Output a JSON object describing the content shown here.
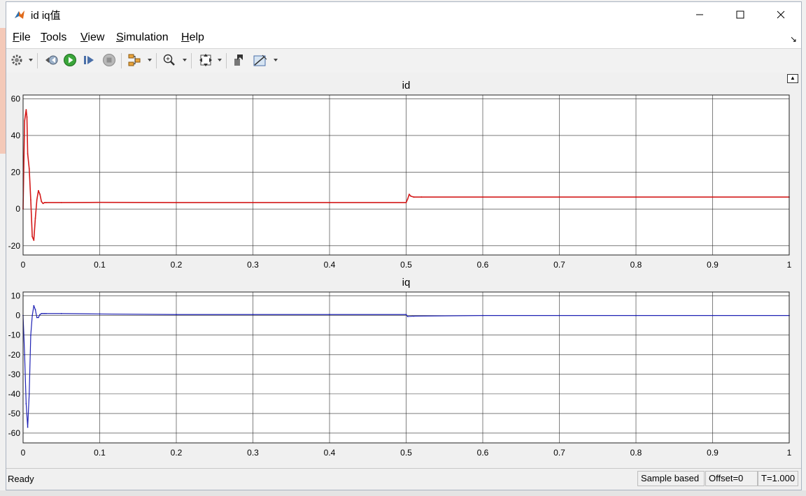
{
  "window": {
    "title": "id iq值",
    "minimize_icon": "minimize-icon",
    "maximize_icon": "maximize-icon",
    "close_icon": "close-icon"
  },
  "menu": {
    "items": [
      {
        "label": "File",
        "accel": "F",
        "rest": "ile"
      },
      {
        "label": "Tools",
        "accel": "T",
        "rest": "ools"
      },
      {
        "label": "View",
        "accel": "V",
        "rest": "iew"
      },
      {
        "label": "Simulation",
        "accel": "S",
        "rest": "imulation"
      },
      {
        "label": "Help",
        "accel": "H",
        "rest": "elp"
      }
    ]
  },
  "toolbar": {
    "icons": [
      "gear-icon",
      "step-back-icon",
      "run-icon",
      "step-forward-icon",
      "stop-icon",
      "signal-select-icon",
      "zoom-icon",
      "fit-icon",
      "highlight-icon",
      "measure-icon"
    ]
  },
  "status": {
    "ready": "Ready",
    "sample_mode": "Sample based",
    "offset": "Offset=0",
    "time": "T=1.000"
  },
  "colors": {
    "id_line": "#d41a1a",
    "iq_line": "#1f22b4",
    "grid": "#2b2b2b"
  },
  "chart_data": [
    {
      "type": "line",
      "title": "id",
      "xlim": [
        0,
        1
      ],
      "ylim": [
        -25,
        62
      ],
      "xticks": [
        0,
        0.1,
        0.2,
        0.3,
        0.4,
        0.5,
        0.6,
        0.7,
        0.8,
        0.9,
        1
      ],
      "xtick_labels": [
        "0",
        "0.1",
        "0.2",
        "0.3",
        "0.4",
        "0.5",
        "0.6",
        "0.7",
        "0.8",
        "0.9",
        "1"
      ],
      "yticks": [
        -20,
        0,
        20,
        40,
        60
      ],
      "ytick_labels": [
        "-20",
        "0",
        "20",
        "40",
        "60"
      ],
      "grid": true,
      "series": [
        {
          "x": [
            0,
            0.002,
            0.004,
            0.005,
            0.006,
            0.008,
            0.01,
            0.012,
            0.014,
            0.016,
            0.018,
            0.02,
            0.022,
            0.024,
            0.026,
            0.028,
            0.03,
            0.05,
            0.1,
            0.2,
            0.3,
            0.4,
            0.5,
            0.502,
            0.504,
            0.506,
            0.51,
            0.52,
            0.6,
            0.7,
            0.8,
            0.9,
            1.0
          ],
          "y": [
            0,
            48,
            54,
            50,
            30,
            22,
            5,
            -15,
            -17,
            -5,
            5,
            10,
            8,
            4,
            3,
            3.5,
            3.5,
            3.5,
            3.6,
            3.5,
            3.5,
            3.5,
            3.5,
            5.5,
            8,
            7,
            6.5,
            6.5,
            6.5,
            6.5,
            6.5,
            6.5,
            6.5
          ]
        }
      ]
    },
    {
      "type": "line",
      "title": "iq",
      "xlim": [
        0,
        1
      ],
      "ylim": [
        -65,
        12
      ],
      "xticks": [
        0,
        0.1,
        0.2,
        0.3,
        0.4,
        0.5,
        0.6,
        0.7,
        0.8,
        0.9,
        1
      ],
      "xtick_labels": [
        "0",
        "0.1",
        "0.2",
        "0.3",
        "0.4",
        "0.5",
        "0.6",
        "0.7",
        "0.8",
        "0.9",
        "1"
      ],
      "yticks": [
        -60,
        -50,
        -40,
        -30,
        -20,
        -10,
        0,
        10
      ],
      "ytick_labels": [
        "-60",
        "-50",
        "-40",
        "-30",
        "-20",
        "-10",
        "0",
        "10"
      ],
      "grid": true,
      "series": [
        {
          "x": [
            0,
            0.002,
            0.004,
            0.006,
            0.008,
            0.01,
            0.012,
            0.014,
            0.016,
            0.018,
            0.02,
            0.022,
            0.024,
            0.026,
            0.028,
            0.03,
            0.05,
            0.1,
            0.2,
            0.3,
            0.4,
            0.5,
            0.502,
            0.51,
            0.6,
            0.7,
            0.8,
            0.9,
            1.0
          ],
          "y": [
            0,
            -20,
            -45,
            -57,
            -40,
            -10,
            0,
            5,
            3,
            -1,
            -1,
            0.5,
            1,
            1,
            1,
            1,
            1,
            0.8,
            0.5,
            0.5,
            0.5,
            0.5,
            -0.5,
            -0.3,
            0,
            0,
            0,
            0,
            0
          ]
        }
      ]
    }
  ]
}
